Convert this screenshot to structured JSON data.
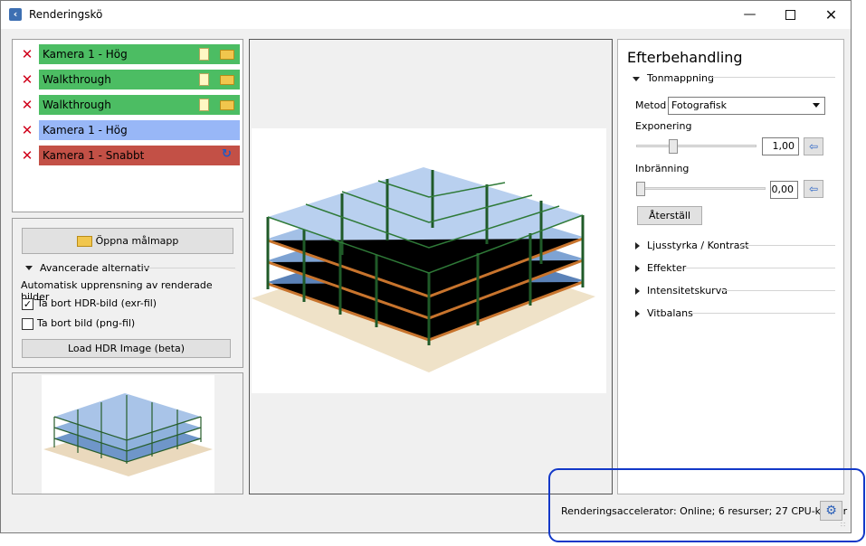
{
  "window": {
    "title": "Renderingskö",
    "icon": "app-icon",
    "controls": [
      "minimize-icon",
      "maximize-icon",
      "close-icon"
    ]
  },
  "queue": {
    "items": [
      {
        "label": "Kamera 1 - Hög",
        "status_color": "#4cbd63",
        "icons": [
          "clipboard-icon",
          "folder-icon"
        ]
      },
      {
        "label": "Walkthrough",
        "status_color": "#4cbd63",
        "icons": [
          "clipboard-icon",
          "folder-icon"
        ]
      },
      {
        "label": "Walkthrough",
        "status_color": "#4cbd63",
        "icons": [
          "clipboard-icon",
          "folder-icon"
        ]
      },
      {
        "label": "Kamera 1 - Hög",
        "status_color": "#98b7f7",
        "icons": []
      },
      {
        "label": "Kamera 1 - Snabbt",
        "status_color": "#c35046",
        "icons": [
          "refresh-icon"
        ]
      }
    ]
  },
  "options": {
    "open_folder_label": "Öppna målmapp",
    "advanced_label": "Avancerade alternativ",
    "auto_cleanup_label": "Automatisk upprensning av renderade bilder",
    "delete_hdr_label": "Ta bort HDR-bild (exr-fil)",
    "delete_hdr_checked": true,
    "delete_png_label": "Ta bort bild (png-fil)",
    "delete_png_checked": false,
    "load_hdr_label": "Load HDR Image (beta)"
  },
  "post": {
    "title": "Efterbehandling",
    "tonemapping_label": "Tonmappning",
    "method_label": "Metod",
    "method_value": "Fotografisk",
    "exposure_label": "Exponering",
    "exposure_value": "1,00",
    "exposure_level": 0.31,
    "burn_label": "Inbränning",
    "burn_value": "0,00",
    "burn_level": 0.0,
    "reset_label": "Återställ",
    "sections": [
      "Ljusstyrka / Kontrast",
      "Effekter",
      "Intensitetskurva",
      "Vitbalans"
    ]
  },
  "status": {
    "text": "Renderingsaccelerator: Online; 6 resurser; 27 CPU-kärnor",
    "settings_icon": "gear-icon"
  },
  "colors": {
    "accent": "#1238c8",
    "done": "#4cbd63",
    "pending": "#98b7f7",
    "active": "#c35046"
  }
}
